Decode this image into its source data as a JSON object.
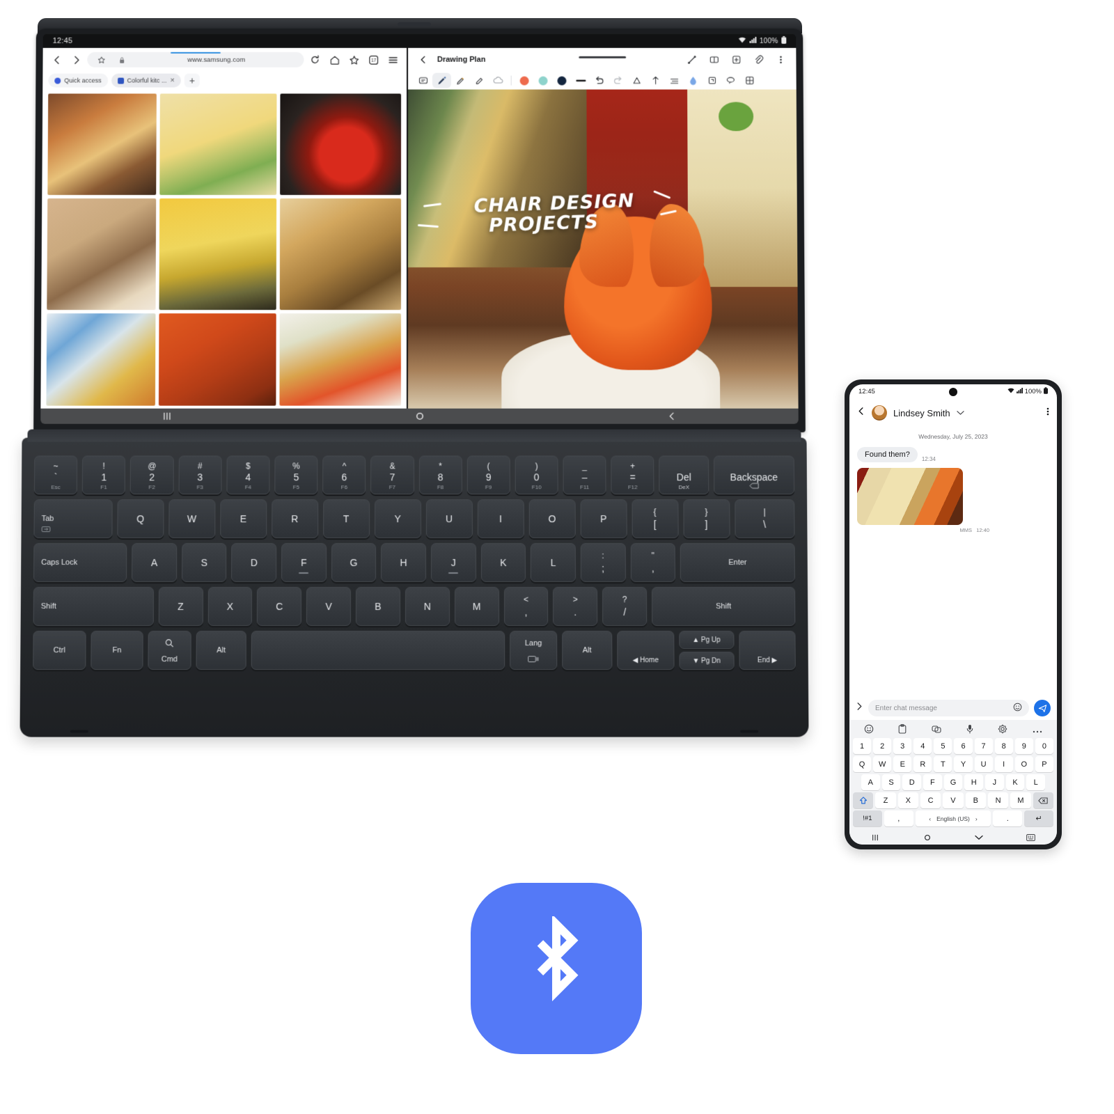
{
  "tablet": {
    "statusbar": {
      "time": "12:45",
      "battery": "100%",
      "icons": [
        "wifi-icon",
        "signal-icon",
        "battery-icon"
      ]
    },
    "browser": {
      "url": "www.samsung.com",
      "toolbar_icons": [
        "back-icon",
        "forward-icon",
        "bookmark-star-icon",
        "lock-icon",
        "reload-icon",
        "home-icon",
        "favorites-icon",
        "tabs-count-icon",
        "menu-icon"
      ],
      "tabs_count": "17",
      "tabs": [
        {
          "label": "Quick access",
          "active": false
        },
        {
          "label": "Colorful kitc ...",
          "active": true
        }
      ],
      "new_tab_label": "+",
      "close_tab_label": "×"
    },
    "notes": {
      "title": "Drawing Plan",
      "header_icons": [
        "pen-settings-icon",
        "split-view-icon",
        "add-page-icon",
        "attachment-icon",
        "more-options-icon"
      ],
      "tools": [
        "text-box-icon",
        "pen-icon",
        "highlighter-icon",
        "eraser-icon",
        "cloud-icon"
      ],
      "colors": [
        "#ee6b4d",
        "#8ed3cc",
        "#14263f"
      ],
      "more_tools": [
        "line-weight-icon",
        "undo-icon",
        "redo-icon",
        "shape-icon",
        "transform-icon",
        "align-icon",
        "water-drop-icon",
        "crop-icon",
        "lasso-icon",
        "grid-icon"
      ],
      "canvas_title_line1": "CHAIR DESIGN",
      "canvas_title_line2": "PROJECTS"
    },
    "navbar": {
      "recents": "recents-icon",
      "home": "home-icon",
      "back": "back-icon"
    },
    "keyboard": {
      "row1": [
        {
          "sym": "~",
          "num": "`",
          "fn": "Esc"
        },
        {
          "sym": "!",
          "num": "1",
          "fn": "F1"
        },
        {
          "sym": "@",
          "num": "2",
          "fn": "F2"
        },
        {
          "sym": "#",
          "num": "3",
          "fn": "F3"
        },
        {
          "sym": "$",
          "num": "4",
          "fn": "F4"
        },
        {
          "sym": "%",
          "num": "5",
          "fn": "F5"
        },
        {
          "sym": "^",
          "num": "6",
          "fn": "F6"
        },
        {
          "sym": "&",
          "num": "7",
          "fn": "F7"
        },
        {
          "sym": "*",
          "num": "8",
          "fn": "F8"
        },
        {
          "sym": "(",
          "num": "9",
          "fn": "F9"
        },
        {
          "sym": ")",
          "num": "0",
          "fn": "F10"
        },
        {
          "sym": "_",
          "num": "–",
          "fn": "F11"
        },
        {
          "sym": "+",
          "num": "=",
          "fn": "F12"
        },
        {
          "sym": "Del",
          "num": "",
          "fn": "DeX"
        },
        {
          "sym": "Backspace",
          "num": "",
          "fn": ""
        }
      ],
      "row2": [
        "Tab",
        "Q",
        "W",
        "E",
        "R",
        "T",
        "Y",
        "U",
        "I",
        "O",
        "P",
        "{ [",
        "} ]",
        "|  \\"
      ],
      "row3": [
        "Caps Lock",
        "A",
        "S",
        "D",
        "F",
        "G",
        "H",
        "J",
        "K",
        "L",
        ": ;",
        "\" ,",
        "Enter"
      ],
      "row4": [
        "Shift",
        "Z",
        "X",
        "C",
        "V",
        "B",
        "N",
        "M",
        "< ,",
        "> .",
        "? /",
        "Shift"
      ],
      "row5": [
        "Ctrl",
        "Fn",
        "Cmd",
        "Alt",
        "",
        "Lang",
        "Alt"
      ],
      "nav_keys": {
        "pgup": "Pg Up",
        "pgdn": "Pg Dn",
        "home": "Home",
        "end": "End"
      }
    }
  },
  "phone": {
    "statusbar": {
      "time": "12:45",
      "battery": "100%"
    },
    "chat": {
      "contact": "Lindsey Smith",
      "date_separator": "Wednesday, July 25, 2023",
      "messages": [
        {
          "text": "Found them?",
          "time": "12:34",
          "type": "text"
        },
        {
          "label": "MMS",
          "time": "12:40",
          "type": "image"
        }
      ],
      "input_placeholder": "Enter chat message",
      "header_icons": [
        "back-icon",
        "contact-avatar",
        "chevron-down-icon",
        "more-options-icon"
      ],
      "input_icons": [
        "expand-icon",
        "emoji-icon",
        "send-icon"
      ]
    },
    "keyboard": {
      "tools": [
        "emoji-icon",
        "clipboard-icon",
        "sticker-icon",
        "mic-icon",
        "settings-icon",
        "more-icon"
      ],
      "num_row": [
        "1",
        "2",
        "3",
        "4",
        "5",
        "6",
        "7",
        "8",
        "9",
        "0"
      ],
      "row1": [
        "Q",
        "W",
        "E",
        "R",
        "T",
        "Y",
        "U",
        "I",
        "O",
        "P"
      ],
      "row2": [
        "A",
        "S",
        "D",
        "F",
        "G",
        "H",
        "J",
        "K",
        "L"
      ],
      "row3": [
        "Z",
        "X",
        "C",
        "V",
        "B",
        "N",
        "M"
      ],
      "shift_label": "⇧",
      "backspace_label": "⌧",
      "symbols_label": "!#1",
      "comma_label": ",",
      "period_label": ".",
      "language": "English (US)",
      "enter_label": "↵"
    },
    "navbar": [
      "recents-icon",
      "home-icon",
      "back-icon",
      "keyboard-hide-icon"
    ]
  },
  "bluetooth": {
    "icon": "bluetooth-icon",
    "color": "#5479f7"
  }
}
